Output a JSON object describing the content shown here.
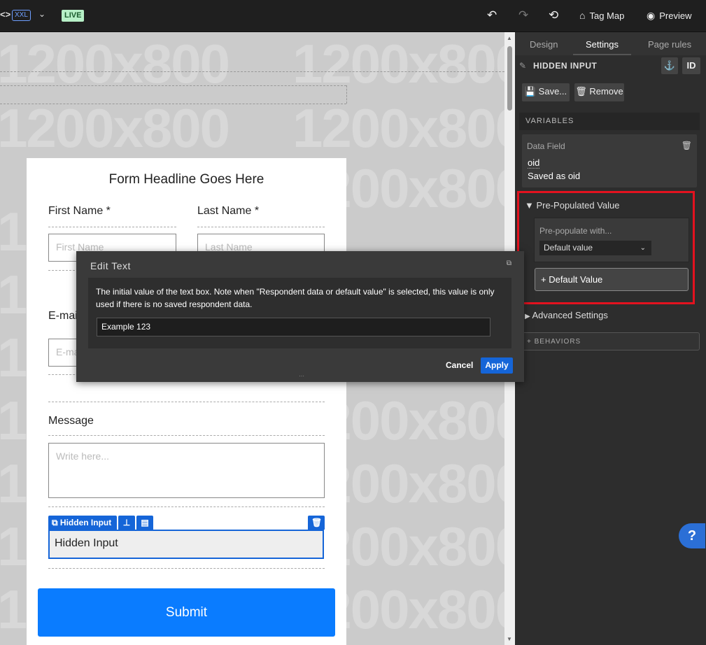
{
  "topbar": {
    "code_icon": "<>",
    "viewport": "XXL",
    "live": "LIVE",
    "undo_icon": "↶",
    "redo_icon": "↷",
    "history_icon": "⟲",
    "tag_map": "Tag Map",
    "preview": "Preview"
  },
  "canvas": {
    "watermark": "1200x800"
  },
  "form": {
    "headline": "Form Headline Goes Here",
    "first_name_label": "First Name *",
    "first_name_placeholder": "First Name",
    "last_name_label": "Last Name *",
    "last_name_placeholder": "Last Name",
    "email_label": "E-mail",
    "email_placeholder": "E-mail",
    "message_label": "Message",
    "message_placeholder": "Write here...",
    "hidden_tool_label": "Hidden Input",
    "hidden_input_text": "Hidden Input",
    "submit": "Submit"
  },
  "panel": {
    "tabs": [
      "Design",
      "Settings",
      "Page rules"
    ],
    "active_tab": "Settings",
    "element_title": "HIDDEN INPUT",
    "id_label": "ID",
    "save_label": "Save...",
    "remove_label": "Remove",
    "variables_header": "VARIABLES",
    "data_field_label": "Data Field",
    "data_field_value": "oid",
    "saved_as": "Saved as oid",
    "prepop_title": "Pre-Populated Value",
    "prepop_with": "Pre-populate with...",
    "prepop_select": "Default value",
    "default_value_button": "+ Default Value",
    "advanced_settings": "Advanced Settings",
    "behaviors": "+ BEHAVIORS",
    "help": "?"
  },
  "modal": {
    "title": "Edit Text",
    "description": "The initial value of the text box. Note when \"Respondent data or default value\" is selected, this value is only used if there is no saved respondent data.",
    "input_value": "Example 123",
    "cancel": "Cancel",
    "apply": "Apply"
  },
  "colors": {
    "accent": "#1565d8",
    "submit": "#0a7cff",
    "highlight": "#e3121f",
    "live_badge": "#b7f0c7"
  }
}
